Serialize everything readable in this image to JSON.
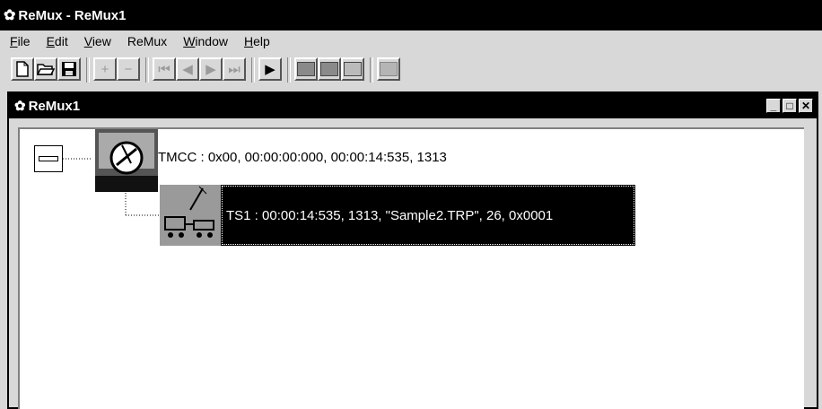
{
  "window": {
    "title": "ReMux - ReMux1"
  },
  "menu": [
    {
      "label": "File",
      "mnemonic": "F",
      "rest": "ile"
    },
    {
      "label": "Edit",
      "mnemonic": "E",
      "rest": "dit"
    },
    {
      "label": "View",
      "mnemonic": "V",
      "rest": "iew"
    },
    {
      "label": "ReMux",
      "mnemonic": "",
      "rest": "ReMux"
    },
    {
      "label": "Window",
      "mnemonic": "W",
      "rest": "indow"
    },
    {
      "label": "Help",
      "mnemonic": "H",
      "rest": "elp"
    }
  ],
  "toolbar": {
    "icons": [
      "new-doc-icon",
      "open-folder-icon",
      "save-icon",
      "add-icon",
      "remove-icon",
      "skip-first-icon",
      "step-back-icon",
      "step-forward-icon",
      "skip-last-icon",
      "play-icon",
      "edit-tmcc-icon",
      "edit-ts-icon",
      "edit-stream-icon",
      "display-icon"
    ],
    "add_glyph": "+",
    "remove_glyph": "−",
    "first_glyph": "⏮",
    "back_glyph": "◀",
    "forward_glyph": "▶",
    "last_glyph": "⏭",
    "play_glyph": "▶"
  },
  "child": {
    "title": "ReMux1",
    "minimize_glyph": "_",
    "maximize_glyph": "□",
    "close_glyph": "✕"
  },
  "tree": {
    "node1": {
      "label": "TMCC : 0x00, 00:00:00:000, 00:00:14:535, 1313",
      "icon": "tmcc-dish-icon",
      "expanded": true
    },
    "node2": {
      "label": "TS1 : 00:00:14:535, 1313, \"Sample2.TRP\", 26, 0x0001",
      "icon": "ts-stream-icon",
      "selected": true
    }
  },
  "colors": {
    "titlebar": "#000000",
    "chrome": "#d8d8d8",
    "tree_bg": "#ffffff",
    "selection_bg": "#000000",
    "selection_text": "#ffffff"
  }
}
